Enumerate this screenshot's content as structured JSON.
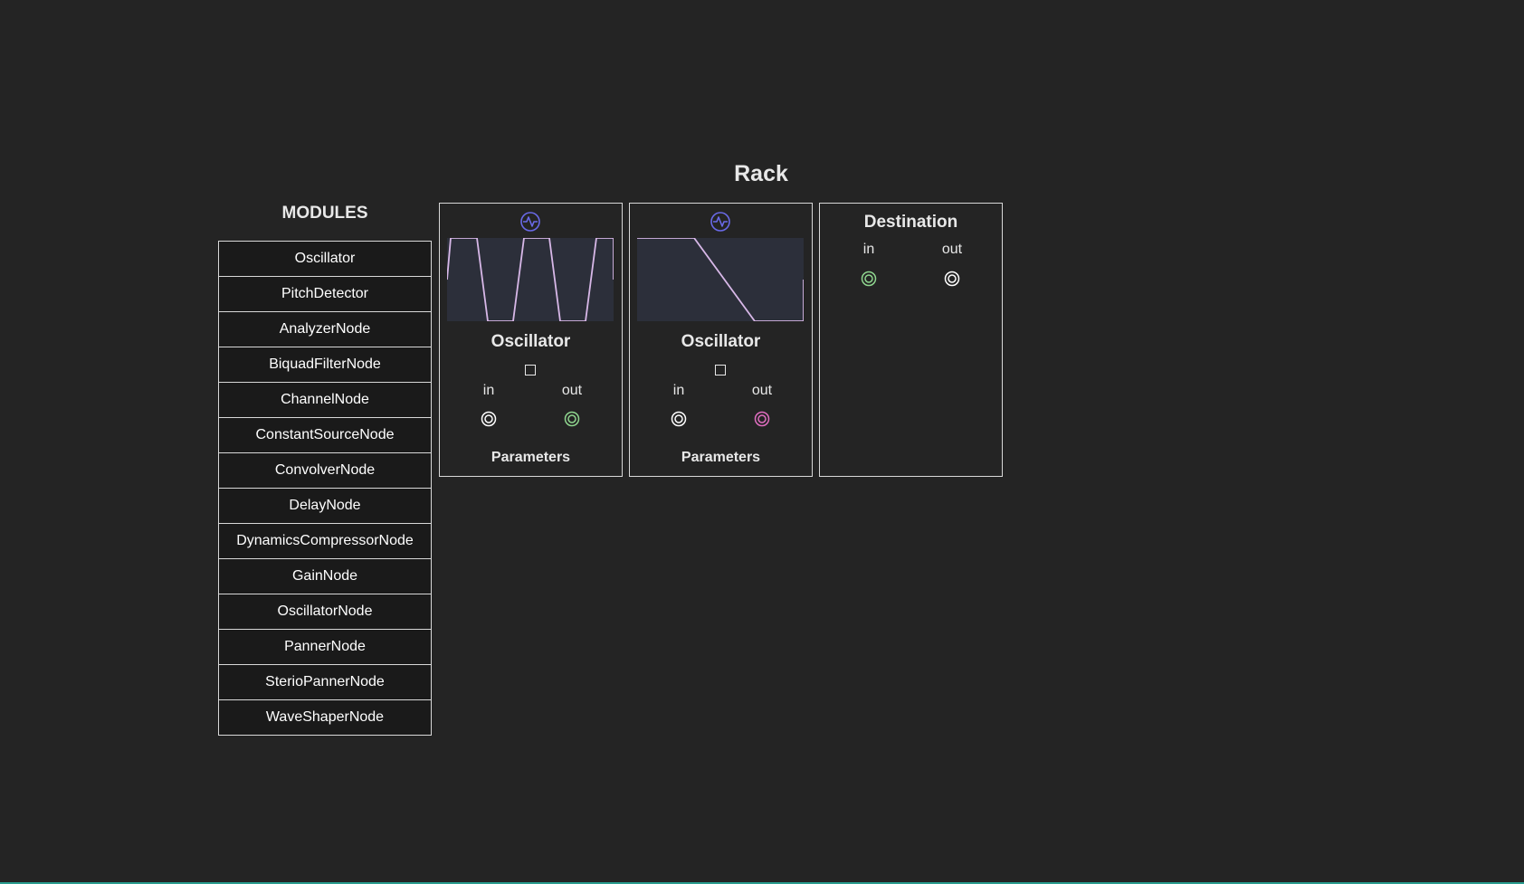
{
  "rack": {
    "title": "Rack"
  },
  "modules_panel": {
    "title": "MODULES",
    "items": [
      {
        "label": "Oscillator"
      },
      {
        "label": "PitchDetector"
      },
      {
        "label": "AnalyzerNode"
      },
      {
        "label": "BiquadFilterNode"
      },
      {
        "label": "ChannelNode"
      },
      {
        "label": "ConstantSourceNode"
      },
      {
        "label": "ConvolverNode"
      },
      {
        "label": "DelayNode"
      },
      {
        "label": "DynamicsCompressorNode"
      },
      {
        "label": "GainNode"
      },
      {
        "label": "OscillatorNode"
      },
      {
        "label": "PannerNode"
      },
      {
        "label": "SterioPannerNode"
      },
      {
        "label": "WaveShaperNode"
      }
    ]
  },
  "cards": {
    "osc1": {
      "icon": "waveform-icon",
      "title": "Oscillator",
      "in_label": "in",
      "out_label": "out",
      "params_label": "Parameters",
      "out_port_color": "#8fd68f"
    },
    "osc2": {
      "icon": "waveform-icon",
      "title": "Oscillator",
      "in_label": "in",
      "out_label": "out",
      "params_label": "Parameters",
      "out_port_color": "#e06ec0"
    },
    "destination": {
      "title": "Destination",
      "in_label": "in",
      "out_label": "out",
      "in_port_color": "#8fd68f",
      "out_port_color": "#ffffff"
    }
  },
  "colors": {
    "background": "#242424",
    "scope_background": "#2c2f3a",
    "waveform_line": "#d8b8e8",
    "icon_accent": "#6a6ae8",
    "border": "#d8d8d8"
  }
}
